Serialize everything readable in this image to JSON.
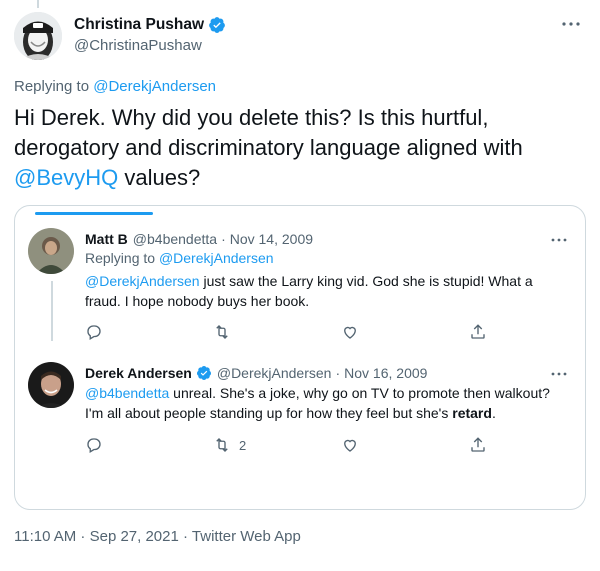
{
  "tweet": {
    "author_name": "Christina Pushaw",
    "author_handle": "@ChristinaPushaw",
    "replying_prefix": "Replying to ",
    "replying_mention": "@DerekjAndersen",
    "text_line1": "Hi Derek. Why did you delete this? Is this hurtful,",
    "text_line2": "derogatory and discriminatory language aligned with",
    "text_mention": "@BevyHQ",
    "text_line3_rest": " values?",
    "footer": "11:10 AM · Sep 27, 2021 · Twitter Web App"
  },
  "quoted": {
    "first": {
      "name": "Matt B",
      "handle": "@b4bendetta",
      "date": "Nov 14, 2009",
      "replying_prefix": "Replying to ",
      "replying_mention": "@DerekjAndersen",
      "body_mention": "@DerekjAndersen",
      "body_line1_rest": " just saw the Larry king vid. God she is stupid! What a",
      "body_line2": "fraud. I hope nobody buys her book."
    },
    "second": {
      "name": "Derek Andersen",
      "handle": "@DerekjAndersen",
      "date": "Nov 16, 2009",
      "body_mention": "@b4bendetta",
      "body_line1_rest": " unreal. She's a joke, why go on TV to promote then walkout?",
      "body_line2_pre": "I'm all about people standing up for how they feel but she's ",
      "body_line2_bold": "retard",
      "body_line2_post": ".",
      "retweet_count": "2"
    },
    "separator": "·"
  },
  "colors": {
    "link": "#1d9bf0",
    "text": "#0f1419",
    "secondary": "#536471",
    "border": "#cfd9de"
  },
  "icons": [
    "verified-badge-icon",
    "more-icon",
    "reply-icon",
    "retweet-icon",
    "like-icon",
    "share-icon"
  ]
}
